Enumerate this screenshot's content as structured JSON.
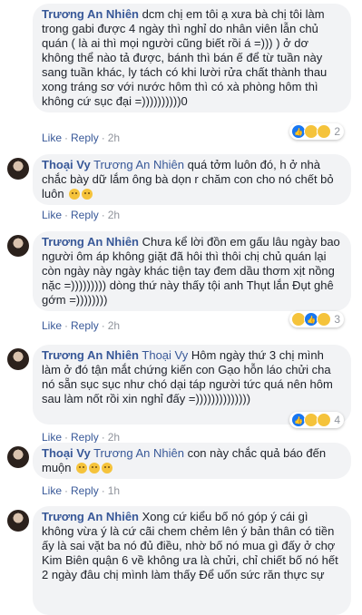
{
  "actions": {
    "like": "Like",
    "reply": "Reply",
    "sep": "·"
  },
  "comments": [
    {
      "author": "Trương An Nhiên",
      "tag": "",
      "text": "dcm chị em tôi ạ xưa bà chị tôi làm trong gabi được 4 ngày thì nghỉ do nhân viên lẫn chủ quán ( là ai thì mọi người cũng biết rồi á =))) ) ở dơ không thể nào tả được, bánh thì bán ế để từ tuần này sang tuần khác, ly tách có khi lười rửa chất thành thau xong tráng sơ với nước hôm thì có xà phòng hôm thì không cứ sục đại =))))))))))0",
      "time": "2h",
      "reactions": [
        "like",
        "haha",
        "sad"
      ],
      "reaction_count": "2"
    },
    {
      "author": "Thoại Vy",
      "tag": "Trương An Nhiên",
      "text": "quá tởm luôn đó, h ở nhà chắc bày dữ lắm ông bà dọn r chăm con cho nó chết bỏ luôn",
      "time": "2h",
      "reactions": [],
      "reaction_count": ""
    },
    {
      "author": "Trương An Nhiên",
      "tag": "",
      "text": "Chưa kể lời đồn em gấu lâu ngày bao người ôm áp không giặt đã hôi thì thôi chị chủ quán lại còn ngày này ngày khác tiện tay đem dầu thơm xịt nồng nặc =))))))))) dòng thứ này thấy tội anh Thụt lắn Đụt ghê gớm =))))))))",
      "time": "2h",
      "reactions": [
        "haha",
        "like",
        "sad"
      ],
      "reaction_count": "3"
    },
    {
      "author": "Trương An Nhiên",
      "tag": "Thoại Vy",
      "text": "Hôm ngày thứ 3 chị mình làm ở đó tận mắt chứng kiến con Gạo hỗn láo chửi cha nó sẵn sục sục như chó dại táp người tức quá nên hôm sau làm nốt rồi xin nghỉ đấy =))))))))))))))",
      "time": "2h",
      "reactions": [
        "like",
        "haha",
        "sad"
      ],
      "reaction_count": "4"
    },
    {
      "author": "Thoại Vy",
      "tag": "Trương An Nhiên",
      "text": "con này chắc quả báo đến muộn",
      "time": "1h",
      "reactions": [],
      "reaction_count": ""
    },
    {
      "author": "Trương An Nhiên",
      "tag": "",
      "text": "Xong cứ kiểu bố nó góp ý cái gì không vừa ý là cứ cãi chem chẻm lên ý bản thân có tiền ấy là sai vặt ba nó đủ điều, nhờ bố nó mua gì đấy ở chợ Kim Biên quận 6 về không ưa là chửi, chỉ chiết bố nó hết 2 ngày đâu chị mình làm thấy  Để uốn sức răn thực sự",
      "time": "",
      "reactions": [],
      "reaction_count": ""
    }
  ]
}
